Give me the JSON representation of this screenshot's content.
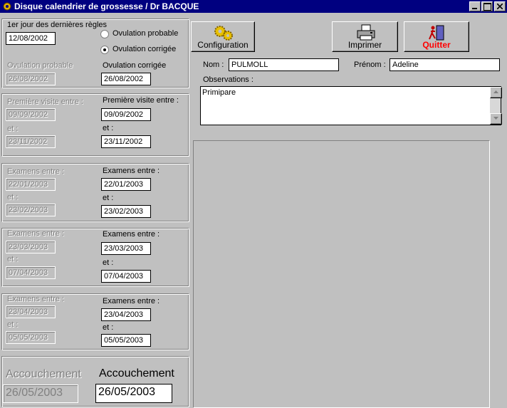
{
  "window": {
    "title": "Disque calendrier de grossesse / Dr BACQUE"
  },
  "lmp": {
    "label": "1er jour des dernières règles",
    "value": "12/08/2002"
  },
  "ovulation": {
    "radio_probable": "Ovulation probable",
    "radio_corrigee": "Ovulation corrigée",
    "selected": "corrigee",
    "probable_label": "Ovulation probable",
    "probable_value": "26/08/2002",
    "corrigee_label": "Ovulation corrigée",
    "corrigee_value": "26/08/2002"
  },
  "groups": [
    {
      "left_label1": "Première visite entre :",
      "left_value1": "09/09/2002",
      "left_label2": "et :",
      "left_value2": "23/11/2002",
      "right_label1": "Première visite entre :",
      "right_value1": "09/09/2002",
      "right_label2": "et :",
      "right_value2": "23/11/2002"
    },
    {
      "left_label1": "Examens entre :",
      "left_value1": "22/01/2003",
      "left_label2": "et :",
      "left_value2": "23/02/2003",
      "right_label1": "Examens entre :",
      "right_value1": "22/01/2003",
      "right_label2": "et :",
      "right_value2": "23/02/2003"
    },
    {
      "left_label1": "Examens entre :",
      "left_value1": "23/03/2003",
      "left_label2": "et :",
      "left_value2": "07/04/2003",
      "right_label1": "Examens entre :",
      "right_value1": "23/03/2003",
      "right_label2": "et :",
      "right_value2": "07/04/2003"
    },
    {
      "left_label1": "Examens entre :",
      "left_value1": "23/04/2003",
      "left_label2": "et :",
      "left_value2": "05/05/2003",
      "right_label1": "Examens entre :",
      "right_value1": "23/04/2003",
      "right_label2": "et :",
      "right_value2": "05/05/2003"
    }
  ],
  "accouchement": {
    "left_label": "Accouchement",
    "left_value": "26/05/2003",
    "right_label": "Accouchement",
    "right_value": "26/05/2003"
  },
  "toolbar": {
    "configuration": "Configuration",
    "imprimer": "Imprimer",
    "quitter": "Quitter"
  },
  "patient": {
    "nom_label": "Nom :",
    "nom_value": "PULMOLL",
    "prenom_label": "Prénom :",
    "prenom_value": "Adeline",
    "observations_label": "Observations :",
    "observations_value": "Primipare"
  },
  "colors": {
    "title_bar": "#000080",
    "face": "#c0c0c0",
    "quitter_text": "#ff0000"
  },
  "icons": {
    "app": "gear-app-icon",
    "config": "gears-icon",
    "print": "printer-icon",
    "quit": "exit-door-icon"
  }
}
